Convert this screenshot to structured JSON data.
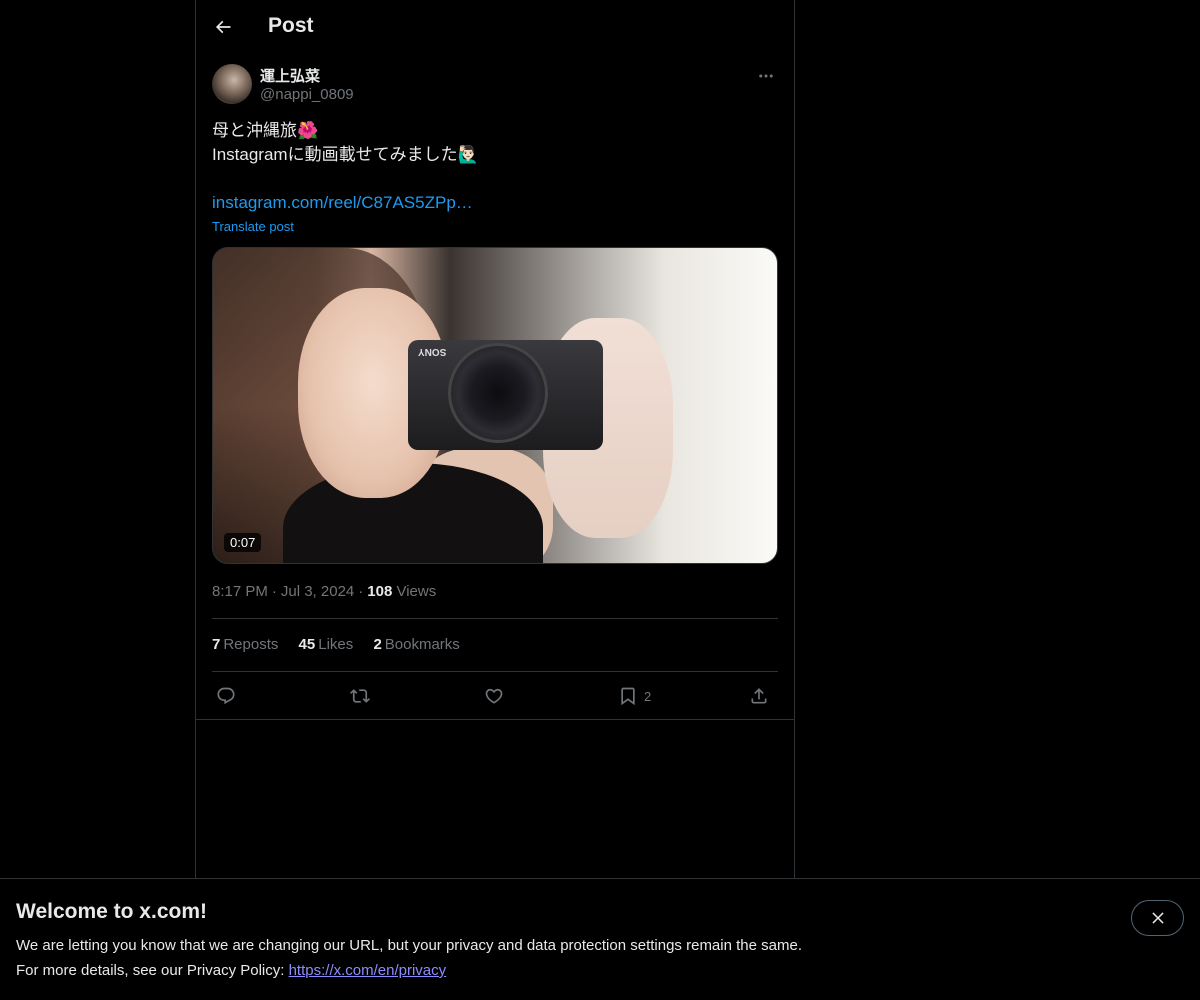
{
  "header": {
    "title": "Post"
  },
  "author": {
    "display_name": "運上弘菜",
    "handle": "@nappi_0809"
  },
  "post": {
    "text_line1": "母と沖縄旅🌺",
    "text_line2": "Instagramに動画載せてみました🙋🏻‍♂️",
    "link_text": "instagram.com/reel/C87AS5ZPp…",
    "translate_label": "Translate post",
    "media_duration": "0:07",
    "media_brand": "SONY"
  },
  "meta": {
    "time": "8:17 PM",
    "date": "Jul 3, 2024",
    "views_count": "108",
    "views_label": "Views"
  },
  "stats": {
    "reposts_count": "7",
    "reposts_label": "Reposts",
    "likes_count": "45",
    "likes_label": "Likes",
    "bookmarks_count": "2",
    "bookmarks_label": "Bookmarks"
  },
  "actions": {
    "reply_icon": "reply-icon",
    "repost_icon": "repost-icon",
    "like_icon": "like-icon",
    "bookmark_icon": "bookmark-icon",
    "bookmark_count": "2",
    "share_icon": "share-icon"
  },
  "banner": {
    "title": "Welcome to x.com!",
    "line1": "We are letting you know that we are changing our URL, but your privacy and data protection settings remain the same.",
    "line2_prefix": "For more details, see our Privacy Policy: ",
    "line2_link": "https://x.com/en/privacy"
  },
  "colors": {
    "background": "#000000",
    "text": "#e7e9ea",
    "muted": "#71767b",
    "link": "#1d9bf0",
    "border": "#2f3336"
  }
}
